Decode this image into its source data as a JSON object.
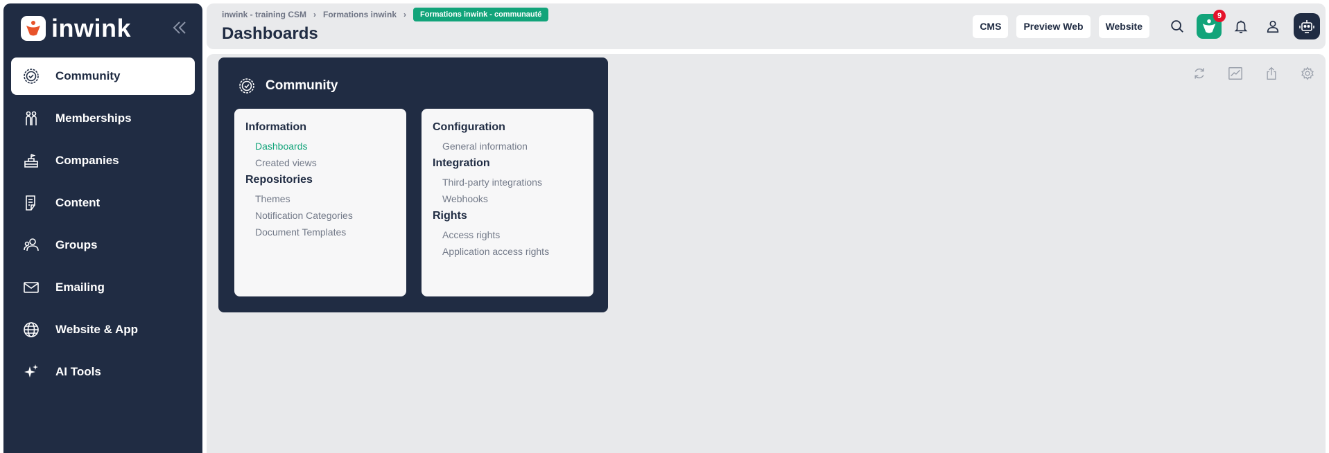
{
  "brand": {
    "name": "inwink",
    "accent": "#12a47a",
    "dark": "#202c43"
  },
  "sidebar": {
    "items": [
      {
        "label": "Community",
        "icon": "community-badge-icon",
        "active": true
      },
      {
        "label": "Memberships",
        "icon": "people-icon",
        "active": false
      },
      {
        "label": "Companies",
        "icon": "company-podium-icon",
        "active": false
      },
      {
        "label": "Content",
        "icon": "document-icon",
        "active": false
      },
      {
        "label": "Groups",
        "icon": "groups-icon",
        "active": false
      },
      {
        "label": "Emailing",
        "icon": "envelope-icon",
        "active": false
      },
      {
        "label": "Website & App",
        "icon": "globe-icon",
        "active": false
      },
      {
        "label": "AI Tools",
        "icon": "sparkles-icon",
        "active": false
      }
    ]
  },
  "header": {
    "breadcrumb": [
      "inwink - training CSM",
      "Formations inwink",
      "Formations inwink - communauté"
    ],
    "title": "Dashboards",
    "buttons": {
      "cms": "CMS",
      "preview": "Preview Web",
      "website": "Website"
    },
    "notification_count": "9"
  },
  "panel": {
    "title": "Community",
    "left_card": {
      "sections": [
        {
          "title": "Information",
          "links": [
            "Dashboards",
            "Created views"
          ]
        },
        {
          "title": "Repositories",
          "links": [
            "Themes",
            "Notification Categories",
            "Document Templates"
          ]
        }
      ]
    },
    "right_card": {
      "sections": [
        {
          "title": "Configuration",
          "links": [
            "General information"
          ]
        },
        {
          "title": "Integration",
          "links": [
            "Third-party integrations",
            "Webhooks"
          ]
        },
        {
          "title": "Rights",
          "links": [
            "Access rights",
            "Application access rights"
          ]
        }
      ]
    }
  }
}
